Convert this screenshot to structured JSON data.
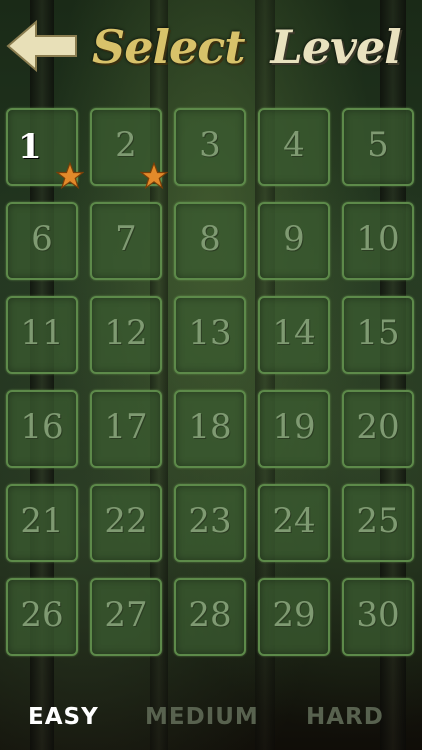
{
  "header": {
    "title_word_1": "Select",
    "title_word_2": "Level",
    "back_icon": "back-arrow-icon"
  },
  "levels": [
    {
      "number": "1",
      "unlocked": true
    },
    {
      "number": "2"
    },
    {
      "number": "3"
    },
    {
      "number": "4"
    },
    {
      "number": "5"
    },
    {
      "number": "6"
    },
    {
      "number": "7"
    },
    {
      "number": "8"
    },
    {
      "number": "9"
    },
    {
      "number": "10"
    },
    {
      "number": "11"
    },
    {
      "number": "12"
    },
    {
      "number": "13"
    },
    {
      "number": "14"
    },
    {
      "number": "15"
    },
    {
      "number": "16"
    },
    {
      "number": "17"
    },
    {
      "number": "18"
    },
    {
      "number": "19"
    },
    {
      "number": "20"
    },
    {
      "number": "21"
    },
    {
      "number": "22"
    },
    {
      "number": "23"
    },
    {
      "number": "24"
    },
    {
      "number": "25"
    },
    {
      "number": "26"
    },
    {
      "number": "27"
    },
    {
      "number": "28"
    },
    {
      "number": "29"
    },
    {
      "number": "30"
    }
  ],
  "stars": {
    "earned": 2,
    "color": "#e38a2a"
  },
  "difficulty_tabs": {
    "easy": "EASY",
    "medium": "MEDIUM",
    "hard": "HARD",
    "selected": "easy"
  }
}
